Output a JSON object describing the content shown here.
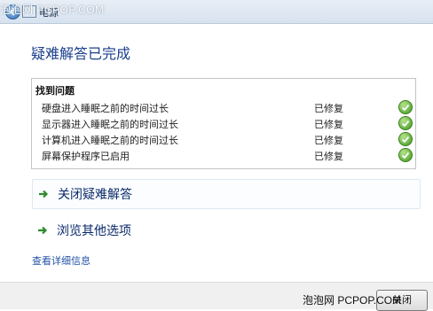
{
  "window": {
    "breadcrumb": "电源",
    "watermark_top": "泡泡网 PCPOP.COM"
  },
  "page": {
    "heading": "疑难解答已完成"
  },
  "results": {
    "title": "找到问题",
    "rows": [
      {
        "issue": "硬盘进入睡眠之前的时间过长",
        "status": "已修复"
      },
      {
        "issue": "显示器进入睡眠之前的时间过长",
        "status": "已修复"
      },
      {
        "issue": "计算机进入睡眠之前的时间过长",
        "status": "已修复"
      },
      {
        "issue": "屏幕保护程序已启用",
        "status": "已修复"
      }
    ]
  },
  "actions": {
    "close_troubleshooting": "关闭疑难解答",
    "browse_options": "浏览其他选项"
  },
  "links": {
    "view_details": "查看详细信息"
  },
  "footer": {
    "close_button": "关闭",
    "watermark": "泡泡网 PCPOP.COM"
  },
  "colors": {
    "heading": "#1a3e8c",
    "link": "#2452a6",
    "check": "#3f9a1e"
  },
  "icons": [
    "back-arrow-icon",
    "power-options-icon",
    "green-check-icon",
    "green-arrow-icon"
  ]
}
